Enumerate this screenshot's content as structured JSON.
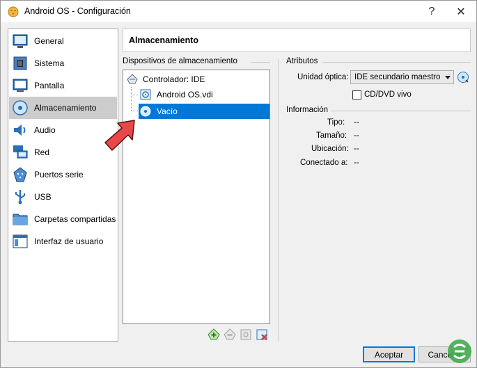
{
  "window": {
    "title": "Android OS - Configuración",
    "help_label": "?",
    "close_label": "✕"
  },
  "sidebar": {
    "items": [
      {
        "label": "General",
        "icon": "general-icon"
      },
      {
        "label": "Sistema",
        "icon": "system-icon"
      },
      {
        "label": "Pantalla",
        "icon": "display-icon"
      },
      {
        "label": "Almacenamiento",
        "icon": "storage-icon",
        "active": true
      },
      {
        "label": "Audio",
        "icon": "audio-icon"
      },
      {
        "label": "Red",
        "icon": "network-icon"
      },
      {
        "label": "Puertos serie",
        "icon": "serial-ports-icon"
      },
      {
        "label": "USB",
        "icon": "usb-icon"
      },
      {
        "label": "Carpetas compartidas",
        "icon": "shared-folders-icon"
      },
      {
        "label": "Interfaz de usuario",
        "icon": "user-interface-icon"
      }
    ]
  },
  "page": {
    "title": "Almacenamiento"
  },
  "storage": {
    "group_label": "Dispositivos de almacenamiento",
    "controller_label": "Controlador: IDE",
    "devices": [
      {
        "label": "Android OS.vdi",
        "icon": "hard-disk-icon",
        "selected": false
      },
      {
        "label": "Vacío",
        "icon": "optical-disc-icon",
        "selected": true
      }
    ]
  },
  "attributes": {
    "group_label": "Atributos",
    "optical_drive_label": "Unidad óptica:",
    "optical_drive_value": "IDE secundario maestro",
    "live_cd_label": "CD/DVD vivo",
    "live_cd_checked": false
  },
  "information": {
    "group_label": "Información",
    "rows": [
      {
        "label": "Tipo:",
        "value": "--"
      },
      {
        "label": "Tamaño:",
        "value": "--"
      },
      {
        "label": "Ubicación:",
        "value": "--"
      },
      {
        "label": "Conectado a:",
        "value": "--"
      }
    ]
  },
  "footer": {
    "accept_label": "Aceptar",
    "cancel_label": "Cancelar"
  },
  "colors": {
    "selection": "#0078d7",
    "sidebar_active": "#cccccc",
    "annotation_arrow": "#e8484a"
  }
}
